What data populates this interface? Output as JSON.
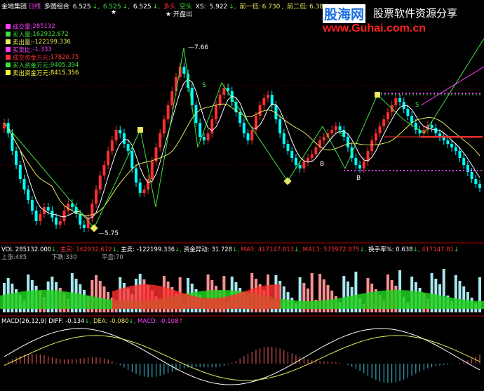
{
  "header": {
    "stock_name": "金地集团",
    "period": "日线",
    "combo": "多图组合",
    "v1": "6.525",
    "v2": "6.525",
    "v3": "6.525",
    "tag1": "多头",
    "tag2": "空头",
    "xs_label": "XS:",
    "xs_value": "5.922",
    "prev_low1_label": "前一低:",
    "prev_low1_value": "6.730",
    "prev_low2_label": "前二低:",
    "prev_low2_value": "6.380",
    "star_label": "开盘出"
  },
  "watermark": {
    "site_name": "股海网",
    "title": "股票软件资源分享",
    "url": "www.Guhai.com.cn"
  },
  "legend": [
    {
      "label": "成交量:",
      "value": "285132",
      "color": "#ff40ff"
    },
    {
      "label": "买入量:",
      "value": "162932.672",
      "color": "#40e040"
    },
    {
      "label": "卖出量:",
      "value": "-122199.336",
      "color": "#e8e860"
    },
    {
      "label": "买卖比:",
      "value": "-1.333",
      "color": "#ff40ff"
    },
    {
      "label": "成交资金万元:",
      "value": "17820.75",
      "color": "#ff3030"
    },
    {
      "label": "买入资金万元:",
      "value": "9405.394",
      "color": "#40e040"
    },
    {
      "label": "卖出资金万元:",
      "value": "8415.356",
      "color": "#ffff40"
    }
  ],
  "price_labels": {
    "high": "7.66",
    "low": "5.75",
    "s": "S",
    "b": "B"
  },
  "vol_bar": {
    "name": "VOL",
    "value": "285132.000",
    "buy_label": "主买:",
    "buy_value": "162932.672",
    "sell_label": "主卖:",
    "sell_value": "-122199.336",
    "flow_label": "资金异动:",
    "flow_value": "31.728",
    "ma5_label": "MA5:",
    "ma5_value": "417147.813",
    "ma13_label": "MA13:",
    "ma13_value": "575972.875",
    "turn_label": "换手率%:",
    "turn_value": "0.638",
    "turn_extra": "417147.81",
    "up_label": "上涨:",
    "up_value": "485",
    "down_label": "下跌:",
    "down_value": "330",
    "flat_label": "平盘:",
    "flat_value": "70"
  },
  "macd_bar": {
    "name": "MACD",
    "params": "(26,12,9)",
    "diff_label": "DIFF:",
    "diff_value": "-0.134",
    "dea_label": "DEA:",
    "dea_value": "-0.080",
    "macd_label": "MACD:",
    "macd_value": "-0.108"
  },
  "colors": {
    "up": "#ff3030",
    "down": "#00ffff",
    "ma_white": "#ffffff",
    "ma_yellow": "#e8e860",
    "zigzag": "#40e040",
    "support": "#ff40ff",
    "divider": "#b00000"
  }
}
